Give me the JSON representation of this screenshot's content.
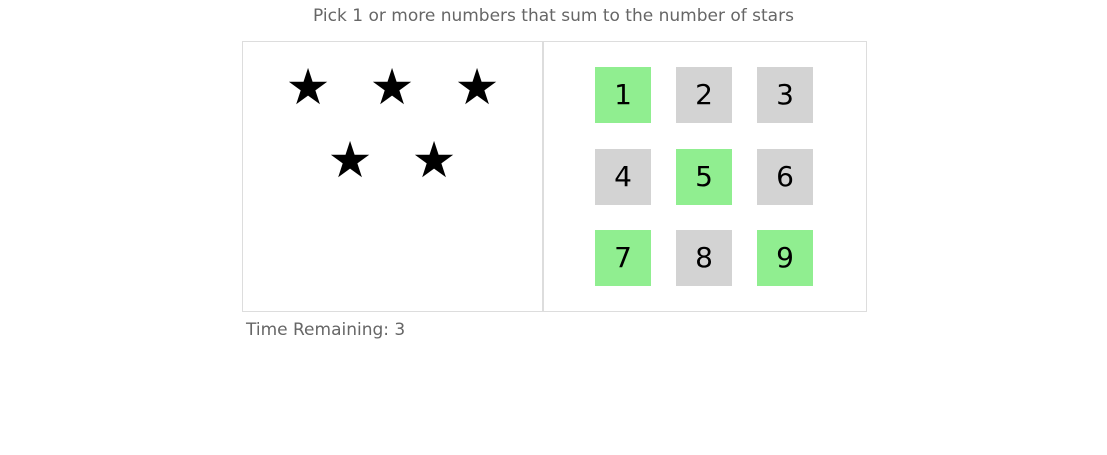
{
  "help_text": "Pick 1 or more numbers that sum to the number of stars",
  "star_count": 5,
  "star_icon": "★",
  "numbers": [
    {
      "label": "1",
      "status": "available",
      "color": "#90ee90"
    },
    {
      "label": "2",
      "status": "used",
      "color": "#d3d3d3"
    },
    {
      "label": "3",
      "status": "used",
      "color": "#d3d3d3"
    },
    {
      "label": "4",
      "status": "used",
      "color": "#d3d3d3"
    },
    {
      "label": "5",
      "status": "available",
      "color": "#90ee90"
    },
    {
      "label": "6",
      "status": "used",
      "color": "#d3d3d3"
    },
    {
      "label": "7",
      "status": "available",
      "color": "#90ee90"
    },
    {
      "label": "8",
      "status": "used",
      "color": "#d3d3d3"
    },
    {
      "label": "9",
      "status": "available",
      "color": "#90ee90"
    }
  ],
  "timer": "Time Remaining: 3"
}
